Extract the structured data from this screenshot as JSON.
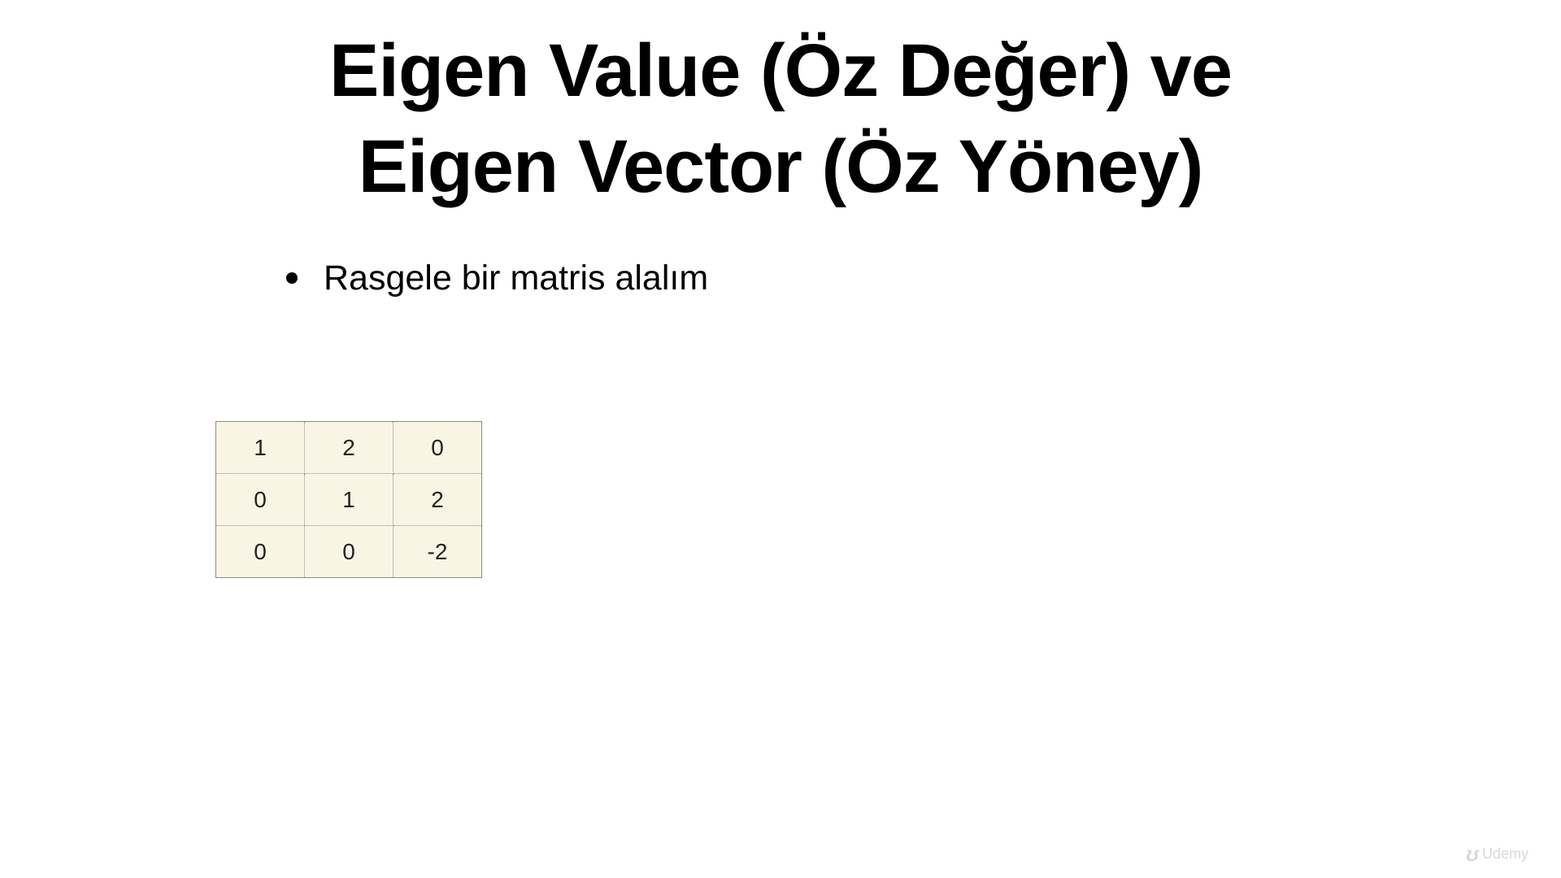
{
  "slide": {
    "title_lines": [
      "Eigen Value (Öz Değer) ve",
      "Eigen Vector (Öz Yöney)"
    ],
    "bullets": [
      "Rasgele bir matris alalım"
    ],
    "matrix": [
      [
        "1",
        "2",
        "0"
      ],
      [
        "0",
        "1",
        "2"
      ],
      [
        "0",
        "0",
        "-2"
      ]
    ]
  },
  "watermark": {
    "text": "Udemy",
    "icon": "udemy-logo-icon"
  },
  "colors": {
    "matrix_background": "#f8f5e4",
    "matrix_border": "#8a8a80"
  }
}
